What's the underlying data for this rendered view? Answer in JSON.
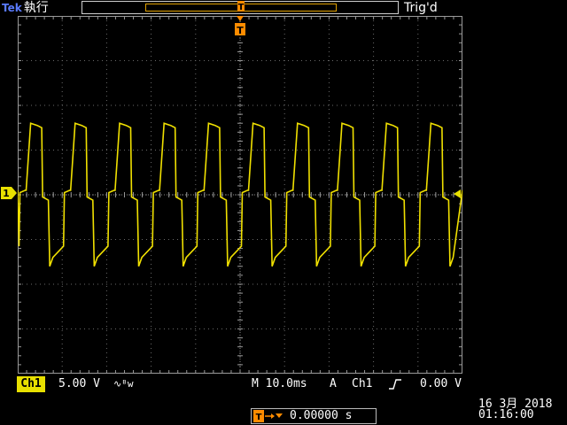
{
  "header": {
    "brand": "Tek",
    "acq_state": "執行",
    "trigger_status": "Trig'd"
  },
  "channel1": {
    "label": "Ch1",
    "marker": "1",
    "volts_per_div": "5.00 V",
    "bandwidth_icon": "∿ᴮw",
    "color": "#e8e000"
  },
  "timebase": {
    "text": "M 10.0ms"
  },
  "trigger": {
    "source_label": "A",
    "channel": "Ch1",
    "slope_icon": "rising-edge-icon",
    "level": "0.00 V",
    "color": "#ff8c00"
  },
  "horizontal_position": {
    "value": "0.00000 s"
  },
  "datetime": {
    "date": "16 3月  2018",
    "time": "01:16:00"
  },
  "waveform": {
    "period_ms": 10.0,
    "high_div": 1.6,
    "low_div": -1.6,
    "shoulder_div": 0.1
  }
}
